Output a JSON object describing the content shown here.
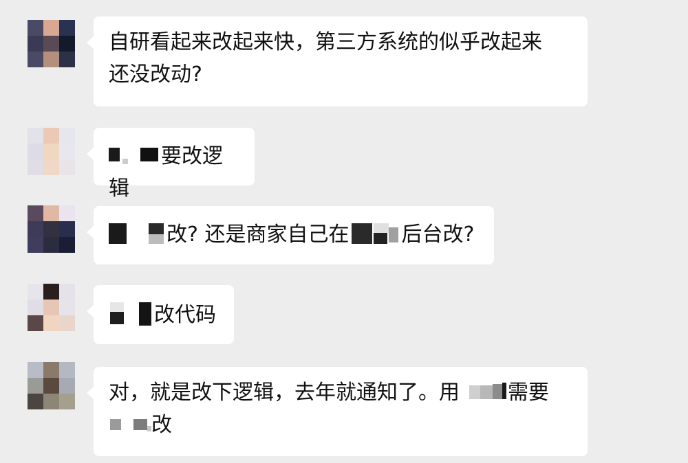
{
  "messages": [
    {
      "lines": [
        "自研看起来改起来快，第三方系统的似乎改起来",
        "还没改动?"
      ]
    },
    {
      "text": "要改逻辑"
    },
    {
      "text_a": "改? 还是商家自己在",
      "text_b": "后台改?"
    },
    {
      "text": "改代码"
    },
    {
      "line1": "对，就是改下逻辑，去年就通知了。用",
      "line1_end": "需要",
      "line2_end": "改"
    }
  ]
}
